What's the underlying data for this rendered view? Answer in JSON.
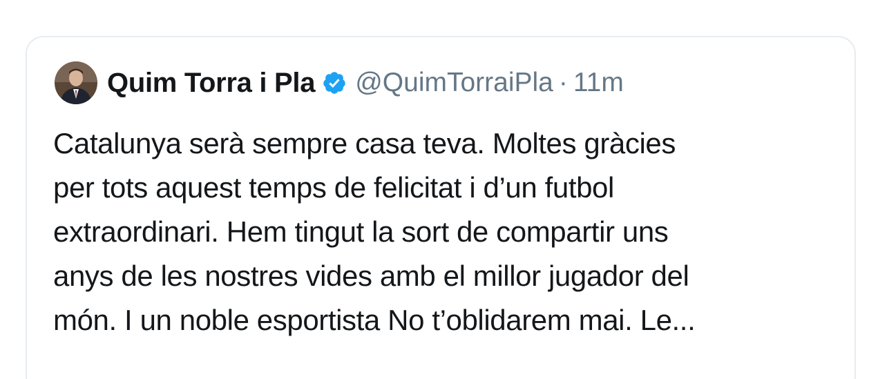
{
  "tweet": {
    "author": {
      "display_name": "Quim Torra i Pla",
      "handle": "@QuimTorraiPla",
      "verified": true,
      "avatar_icon": "profile-photo"
    },
    "separator": "·",
    "timestamp": "11m",
    "text_lines": [
      "Catalunya serà sempre casa teva. Moltes gràcies",
      "per tots aquest temps de felicitat i d’un futbol",
      "extraordinari. Hem tingut la sort de compartir uns",
      "anys de les nostres vides amb el millor jugador del",
      "món. I un noble esportista No t’oblidarem mai. Le..."
    ]
  },
  "colors": {
    "text_primary": "#14171a",
    "text_secondary": "#657786",
    "verified_badge": "#1da1f2",
    "card_border": "#e6ecf0"
  }
}
